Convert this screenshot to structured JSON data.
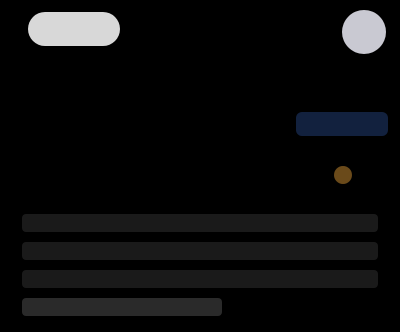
{
  "header": {
    "logo_label": "",
    "title_text": "",
    "avatar_initial": ""
  },
  "main": {
    "headline": "",
    "chip_label": "",
    "meta_left": "",
    "meta_right": "",
    "lines": [
      "",
      "",
      "",
      ""
    ]
  },
  "colors": {
    "background": "#000000",
    "logo": "#d8d8d8",
    "avatar": "#c9c9d2",
    "chip": "#12213e",
    "accent": "#6a4a1a"
  }
}
